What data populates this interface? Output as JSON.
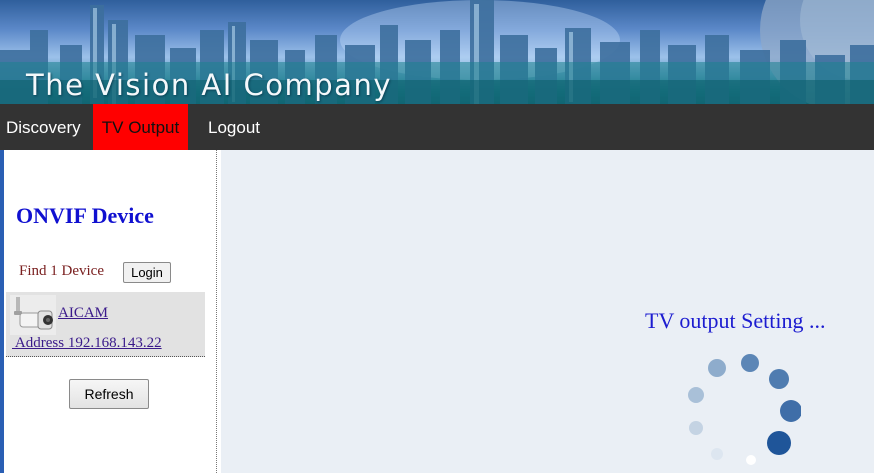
{
  "banner": {
    "title": "The Vision AI Company"
  },
  "nav": {
    "items": [
      {
        "label": "Discovery"
      },
      {
        "label": "TV Output",
        "active": true
      },
      {
        "label": "Logout"
      }
    ],
    "colors": {
      "bar": "#333333",
      "active": "#ff0000"
    }
  },
  "sidebar": {
    "title": "ONVIF Device",
    "device_count": "Find 1 Device",
    "login_label": "Login",
    "devices": [
      {
        "name": "AICAM",
        "address": " Address 192.168.143.22"
      }
    ],
    "refresh_label": "Refresh"
  },
  "main": {
    "status_text": "TV output Setting ..."
  }
}
